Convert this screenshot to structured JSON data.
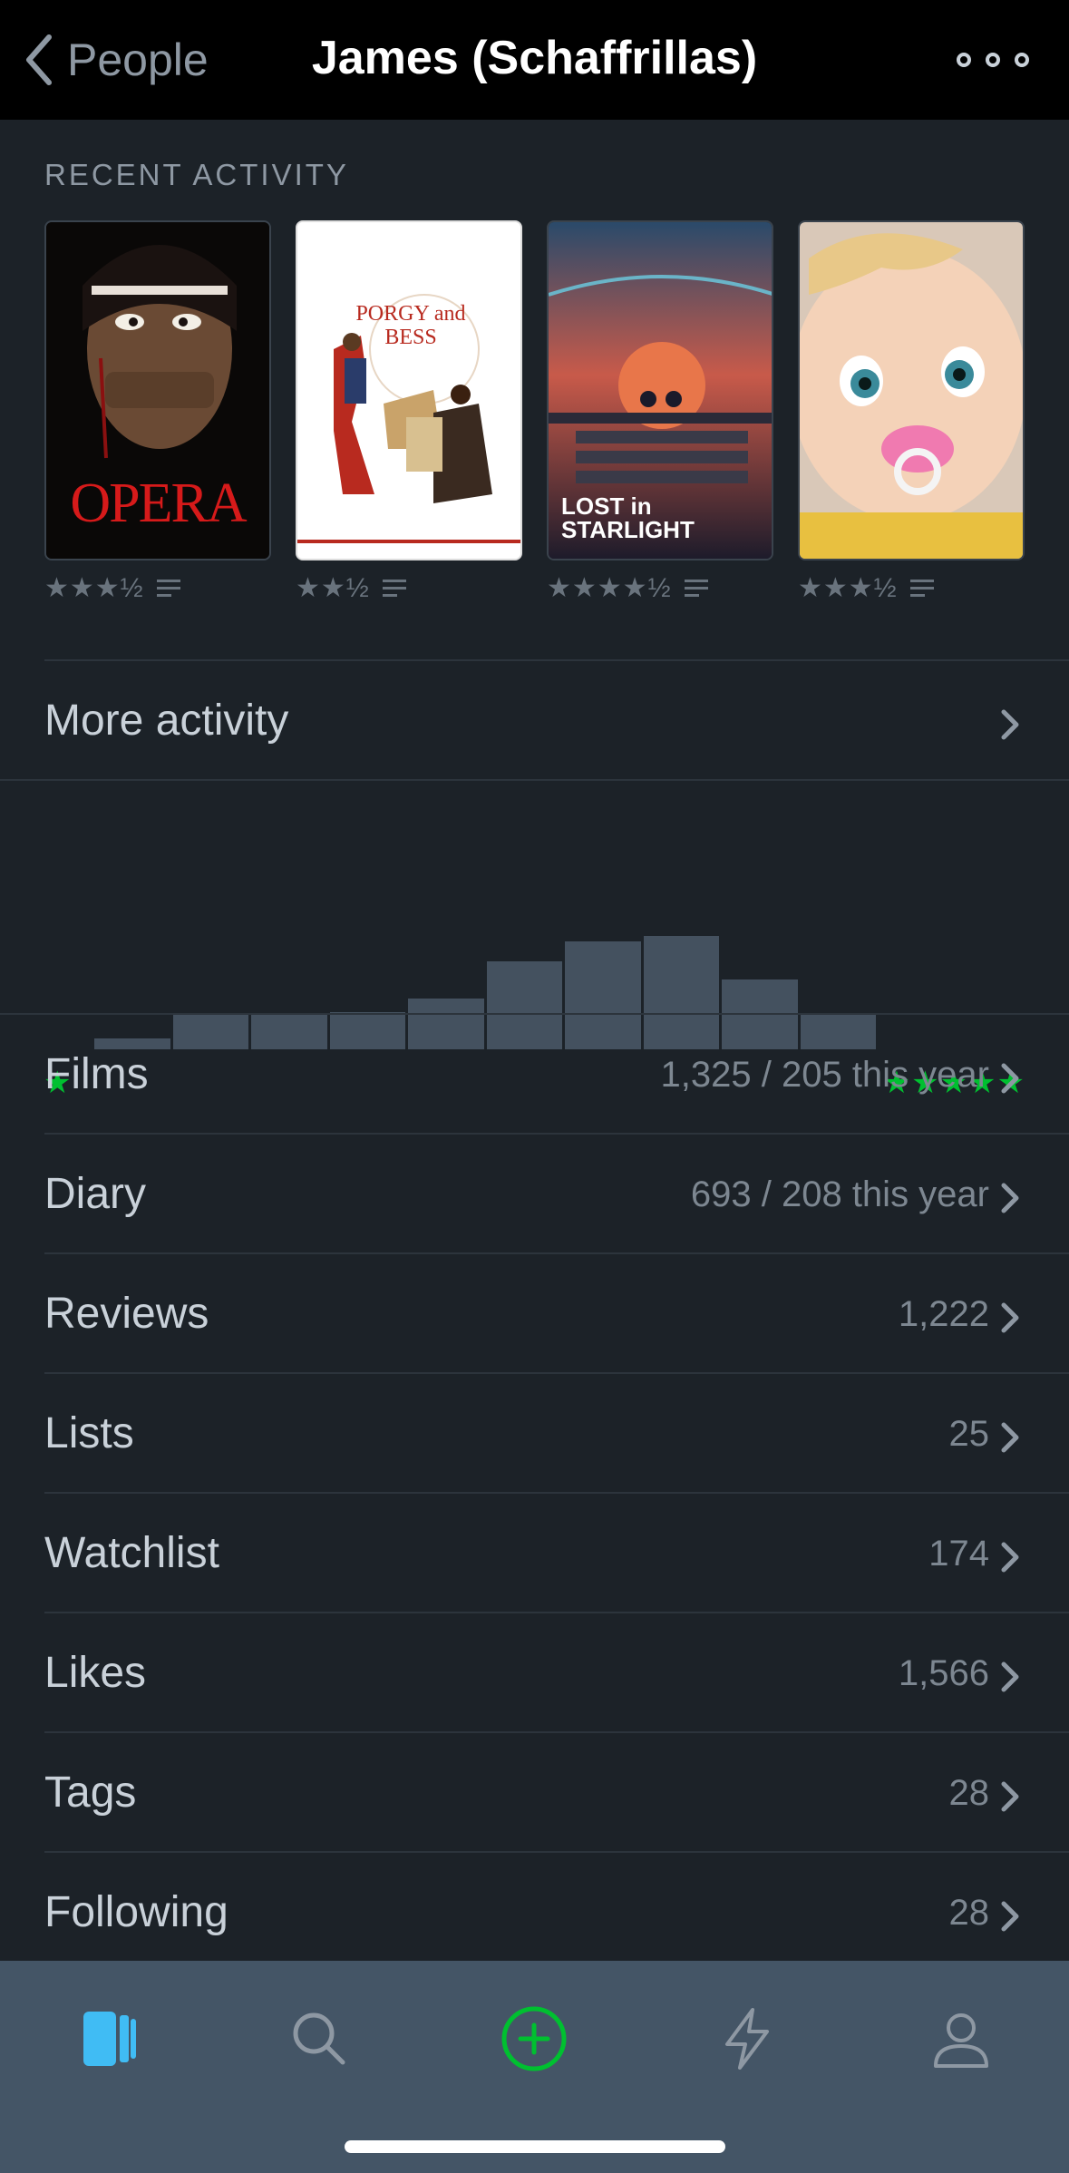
{
  "header": {
    "back_label": "People",
    "title": "James (Schaffrillas)"
  },
  "recent_activity": {
    "label": "RECENT ACTIVITY",
    "items": [
      {
        "title": "OPERA",
        "rating": "★★★½"
      },
      {
        "title": "PORGY and BESS",
        "rating": "★★½"
      },
      {
        "title": "LOST in STARLIGHT",
        "rating": "★★★★½"
      },
      {
        "title": "",
        "rating": "★★★½"
      }
    ]
  },
  "more_activity_label": "More activity",
  "ratings_histogram": {
    "min_label": "★",
    "max_label": "★★★★★",
    "accent_color": "#00c030",
    "bar_color": "#44515f",
    "relative_counts": [
      0.1,
      0.32,
      0.31,
      0.33,
      0.45,
      0.78,
      0.95,
      1.0,
      0.62,
      0.32
    ]
  },
  "stats": [
    {
      "label": "Films",
      "value": "1,325 / 205 this year"
    },
    {
      "label": "Diary",
      "value": "693 / 208 this year"
    },
    {
      "label": "Reviews",
      "value": "1,222"
    },
    {
      "label": "Lists",
      "value": "25"
    },
    {
      "label": "Watchlist",
      "value": "174"
    },
    {
      "label": "Likes",
      "value": "1,566"
    },
    {
      "label": "Tags",
      "value": "28"
    },
    {
      "label": "Following",
      "value": "28"
    }
  ],
  "tabbar": {
    "items": [
      {
        "icon": "films-icon",
        "active": true
      },
      {
        "icon": "search-icon",
        "active": false
      },
      {
        "icon": "add-icon",
        "active": false
      },
      {
        "icon": "activity-icon",
        "active": false
      },
      {
        "icon": "profile-icon",
        "active": false
      }
    ]
  }
}
